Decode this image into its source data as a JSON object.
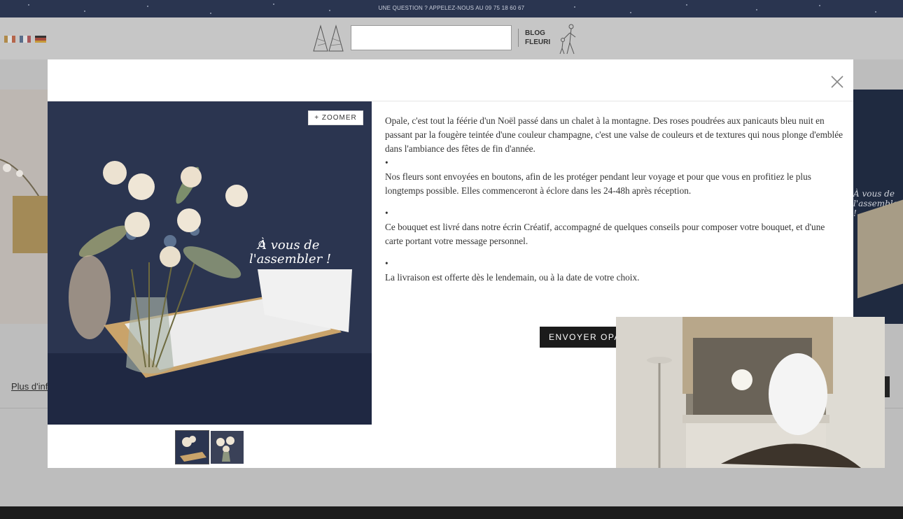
{
  "topbar": {
    "message": "UNE QUESTION ? APPELEZ-NOUS AU 09 75 18 60 67"
  },
  "header": {
    "blog_line1": "BLOG",
    "blog_line2": "FLEURI",
    "search_value": ""
  },
  "background": {
    "more_info": "Plus d'inf",
    "right_banner_line1": "À vous de",
    "right_banner_line2": "l'assembler !"
  },
  "modal": {
    "zoom_label": "+ ZOOMER",
    "image_text_line1": "À vous de",
    "image_text_line2": "l'assembler !",
    "paragraphs": [
      "Opale, c'est tout la féérie d'un Noël passé dans un chalet à la montagne. Des roses poudrées aux panicauts bleu nuit en passant par la fougère teintée d'une couleur champagne, c'est une valse de couleurs et de textures qui nous plonge d'emblée dans l'ambiance des fêtes de fin d'année.",
      "Nos fleurs sont envoyées en boutons, afin de les protéger pendant leur voyage et pour que vous en profitiez le plus longtemps possible. Elles commenceront à éclore dans les 24-48h après réception.",
      "Ce bouquet est livré dans notre écrin Créatif, accompagné de quelques conseils pour composer votre bouquet, et d'une carte portant votre message personnel.",
      "La livraison est offerte dès le lendemain, ou à la date de votre choix."
    ],
    "bullet": "•",
    "send_button": "ENVOYER OPA"
  },
  "colors": {
    "topbar": "#2a3550",
    "image_background": "#2b3550",
    "button": "#1b1b1b"
  },
  "icons": [
    "tree-logo-icon",
    "close-icon",
    "flower-icon"
  ]
}
